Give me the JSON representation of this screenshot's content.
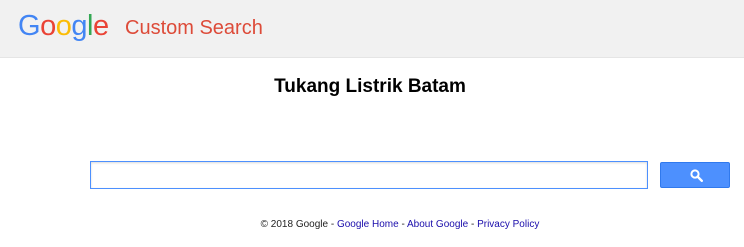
{
  "header": {
    "logo_letters": [
      "G",
      "o",
      "o",
      "g",
      "l",
      "e"
    ],
    "logo_colors": [
      "#4285f4",
      "#ea4335",
      "#fbbc05",
      "#4285f4",
      "#34a853",
      "#ea4335"
    ],
    "product_name": "Custom Search"
  },
  "main": {
    "title": "Tukang Listrik Batam",
    "search": {
      "value": "",
      "placeholder": ""
    },
    "search_button_icon": "search-icon"
  },
  "footer": {
    "copyright": "© 2018 Google",
    "sep1": " - ",
    "link_home": "Google Home",
    "sep2": " - ",
    "link_about": "About Google",
    "sep3": " - ",
    "link_privacy": "Privacy Policy"
  },
  "colors": {
    "header_bg": "#f1f1f1",
    "product_name": "#dd4b39",
    "button_blue": "#4d90fe",
    "link": "#1a0dab"
  }
}
